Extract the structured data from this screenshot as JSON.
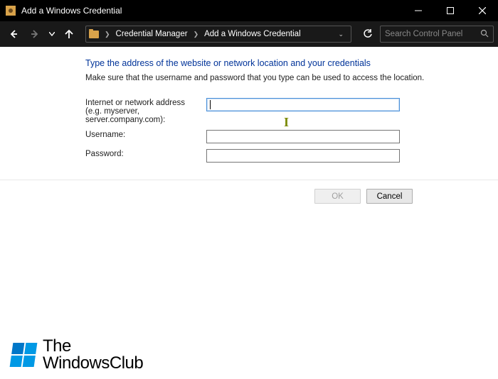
{
  "titlebar": {
    "title": "Add a Windows Credential"
  },
  "breadcrumb": {
    "part1": "Credential Manager",
    "part2": "Add a Windows Credential"
  },
  "search": {
    "placeholder": "Search Control Panel"
  },
  "content": {
    "heading": "Type the address of the website or network location and your credentials",
    "subtext": "Make sure that the username and password that you type can be used to access the location.",
    "fields": {
      "address": {
        "label_line1": "Internet or network address",
        "label_line2": "(e.g. myserver, server.company.com):",
        "value": ""
      },
      "username": {
        "label": "Username:",
        "value": ""
      },
      "password": {
        "label": "Password:",
        "value": ""
      }
    }
  },
  "buttons": {
    "ok": "OK",
    "cancel": "Cancel"
  },
  "watermark": {
    "line1": "The",
    "line2": "WindowsClub"
  }
}
